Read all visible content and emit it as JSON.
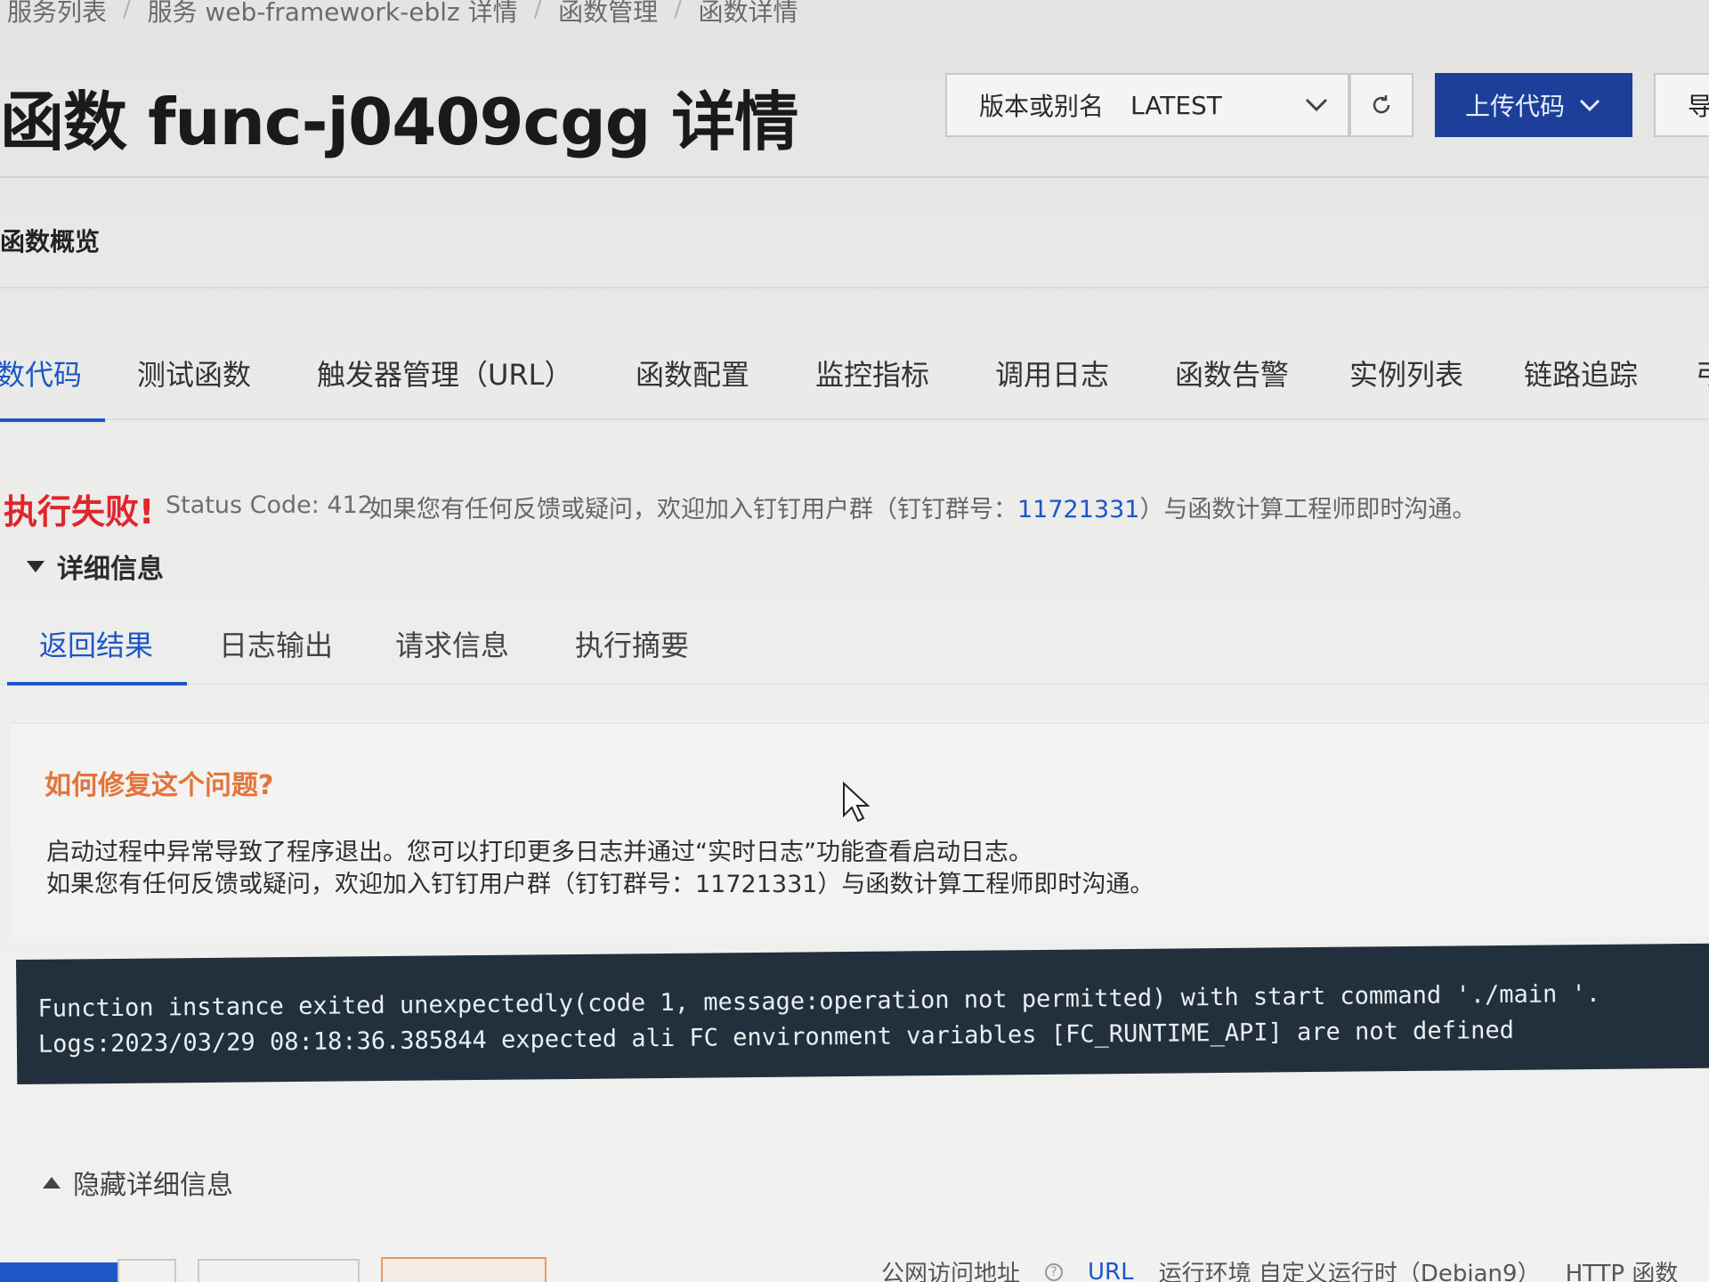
{
  "breadcrumb": {
    "items": [
      "服务列表",
      "服务 web-framework-eblz 详情",
      "函数管理",
      "函数详情"
    ],
    "separator": "/"
  },
  "header": {
    "title": "函数 func-j0409cgg 详情",
    "version_label": "版本或别名",
    "version_value": "LATEST",
    "upload_label": "上传代码",
    "export_label": "导"
  },
  "overview": {
    "label": "函数概览"
  },
  "tabs": [
    {
      "label": "数代码",
      "active": true
    },
    {
      "label": "测试函数"
    },
    {
      "label": "触发器管理（URL）"
    },
    {
      "label": "函数配置"
    },
    {
      "label": "监控指标"
    },
    {
      "label": "调用日志"
    },
    {
      "label": "函数告警"
    },
    {
      "label": "实例列表"
    },
    {
      "label": "链路追踪"
    },
    {
      "label": "弓"
    }
  ],
  "result": {
    "title": "执行失败!",
    "status": "Status Code: 412",
    "message_prefix": "如果您有任何反馈或疑问，欢迎加入钉钉用户群（钉钉群号：",
    "group_number": "11721331",
    "message_suffix": "）与函数计算工程师即时沟通。",
    "details_toggle": "详细信息"
  },
  "subtabs": [
    {
      "label": "返回结果",
      "active": true
    },
    {
      "label": "日志输出"
    },
    {
      "label": "请求信息"
    },
    {
      "label": "执行摘要"
    }
  ],
  "help": {
    "title": "如何修复这个问题?",
    "line1": "启动过程中异常导致了程序退出。您可以打印更多日志并通过“实时日志”功能查看启动日志。",
    "line2": "如果您有任何反馈或疑问，欢迎加入钉钉用户群（钉钉群号：11721331）与函数计算工程师即时沟通。"
  },
  "error_output": {
    "line1": "Function instance exited unexpectedly(code 1, message:operation not permitted) with start command './main '.",
    "line2": "Logs:2023/03/29 08:18:36.385844 expected ali FC environment variables [FC_RUNTIME_API] are not defined"
  },
  "hide_details": {
    "label": "隐藏详细信息"
  },
  "footer": {
    "public_access_label": "公网访问地址",
    "url_label": "URL",
    "runtime": "运行环境 自定义运行时（Debian9）",
    "type": "HTTP 函数"
  },
  "colors": {
    "accent": "#1d56c6",
    "primary_button": "#1d3f9a",
    "error": "#e1252b",
    "help_title": "#e3743a",
    "code_bg": "#22303d"
  },
  "icons": [
    "chevron-down-icon",
    "refresh-icon",
    "triangle-down-icon",
    "triangle-up-icon",
    "help-circle-icon",
    "mouse-cursor-icon"
  ]
}
